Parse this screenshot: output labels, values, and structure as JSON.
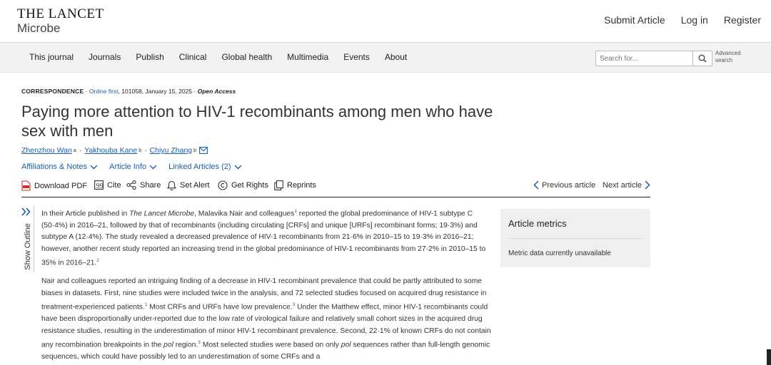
{
  "header": {
    "logo_line1": "THE LANCET",
    "logo_line2": "Microbe",
    "links": [
      "Submit Article",
      "Log in",
      "Register"
    ]
  },
  "nav": {
    "items": [
      "This journal",
      "Journals",
      "Publish",
      "Clinical",
      "Global health",
      "Multimedia",
      "Events",
      "About"
    ],
    "search_placeholder": "Search for...",
    "advanced_line1": "Advanced",
    "advanced_line2": "search"
  },
  "article": {
    "kind": "CORRESPONDENCE",
    "online": "Online first",
    "details": ", 101058, January 15, 2025",
    "access": "Open Access",
    "title": "Paying more attention to HIV-1 recombinants among men who have sex with men",
    "authors": [
      {
        "name": "Zhenzhou Wan",
        "sup": "a"
      },
      {
        "name": "Yakhouba Kane",
        "sup": "b"
      },
      {
        "name": "Chiyu Zhang",
        "sup": "b"
      }
    ],
    "links": [
      "Affiliations & Notes",
      "Article Info",
      "Linked Articles (2)"
    ],
    "tools": [
      "Download PDF",
      "Cite",
      "Share",
      "Set Alert",
      "Get Rights",
      "Reprints"
    ],
    "prev": "Previous article",
    "next": "Next article"
  },
  "outline": {
    "label": "Show Outline"
  },
  "paragraph1": {
    "s1": "In their Article published in ",
    "journal": "The Lancet Microbe",
    "s2": ", Malavika Nair and colleagues",
    "r1": "1",
    "s3": " reported the global predominance of HIV-1 subtype C (50·4%) in 2016–21, followed by that of recombinants (including circulating [CRFs] and unique [URFs] recombinant forms; 19·3%) and subtype A (12·4%). The study revealed a decreased prevalence of HIV-1 recombinants from 21·6% in 2010–15 to 19·3% in 2016–21; however, another recent study reported an increasing trend in the global predominance of HIV-1 recombinants from 27·2% in 2010–15 to 35% in 2016–21.",
    "r2": "2"
  },
  "paragraph2": {
    "s1": "Nair and colleagues reported an intriguing finding of a decrease in HIV-1 recombinant prevalence that could be partly attributed to some biases in datasets. First, nine studies were included twice in the analysis, and 72 selected studies focused on acquired drug resistance in treatment-experienced patients.",
    "r1": "1",
    "s2": " Most CRFs and URFs have low prevalence.",
    "r2": "3",
    "s3": " Under the Matthew effect, minor HIV-1 recombinants could have been disproportionally under-reported due to the low rate of virological failure and relatively small cohort sizes in the acquired drug resistance studies, resulting in the underestimation of minor HIV-1 recombinant prevalence. Second, 22·1% of known CRFs do not contain any recombination breakpoints in the ",
    "pol1": "pol",
    "s4": " region.",
    "r3": "3",
    "s5": " Most selected studies were based on only ",
    "pol2": "pol",
    "s6": " sequences rather than full-length genomic sequences, which could have possibly led to an underestimation of some CRFs and a"
  },
  "metrics": {
    "title": "Article metrics",
    "message": "Metric data currently unavailable"
  },
  "colors": {
    "link": "#1a5fa8",
    "nav_bg": "#f2f2f2",
    "metrics_bg": "#efefef",
    "pdf_red": "#c8302b"
  }
}
